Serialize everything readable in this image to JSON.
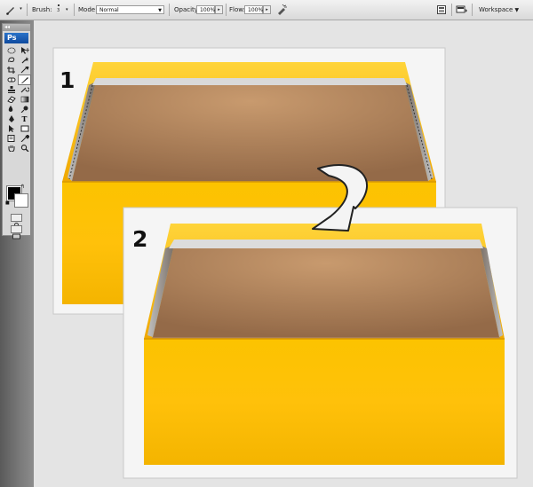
{
  "options_bar": {
    "brush_label": "Brush:",
    "brush_size": "3",
    "mode_label": "Mode:",
    "mode_value": "Normal",
    "opacity_label": "Opacity:",
    "opacity_value": "100%",
    "flow_label": "Flow:",
    "flow_value": "100%",
    "workspace_label": "Workspace"
  },
  "toolbox": {
    "logo": "Ps",
    "collapse": "◂◂"
  },
  "canvas": {
    "step1_label": "1",
    "step2_label": "2"
  },
  "colors": {
    "box_yellow": "#f7b800",
    "box_inside": "#b08660"
  }
}
